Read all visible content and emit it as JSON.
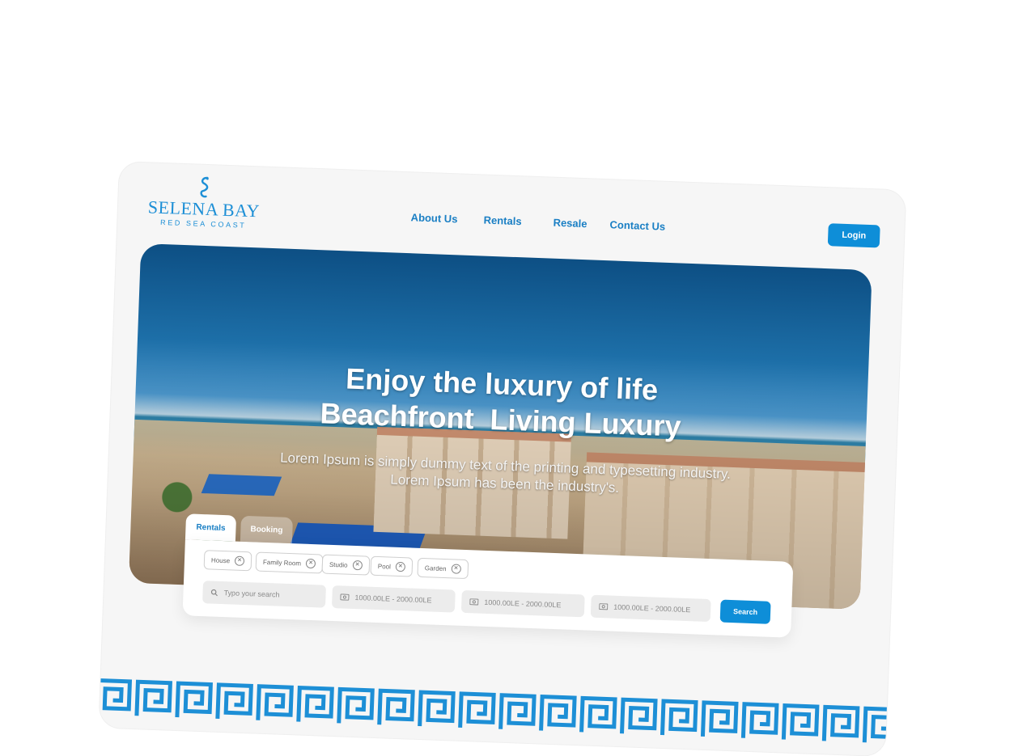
{
  "brand": {
    "name": "SELENA BAY",
    "tagline": "RED SEA COAST",
    "accent": "#1d8fd6",
    "button": "#0e8ed8"
  },
  "nav": {
    "items": [
      "About Us",
      "Rentals",
      "Resale",
      "Contact Us"
    ],
    "login": "Login"
  },
  "hero": {
    "line1": "Enjoy the luxury of life",
    "line2": "Beachfront  Living Luxury",
    "lede": "Lorem Ipsum is simply dummy text of the printing and typesetting industry. Lorem Ipsum has been the industry's."
  },
  "search": {
    "tabs": [
      "Rentals",
      "Booking"
    ],
    "active_tab": "Rentals",
    "chips": [
      "House",
      "Family Room",
      "Studio",
      "Pool",
      "Garden"
    ],
    "placeholder": "Typo your search",
    "ranges": [
      "1000.00LE - 2000.00LE",
      "1000.00LE - 2000.00LE",
      "1000.00LE - 2000.00LE"
    ],
    "button": "Search"
  }
}
